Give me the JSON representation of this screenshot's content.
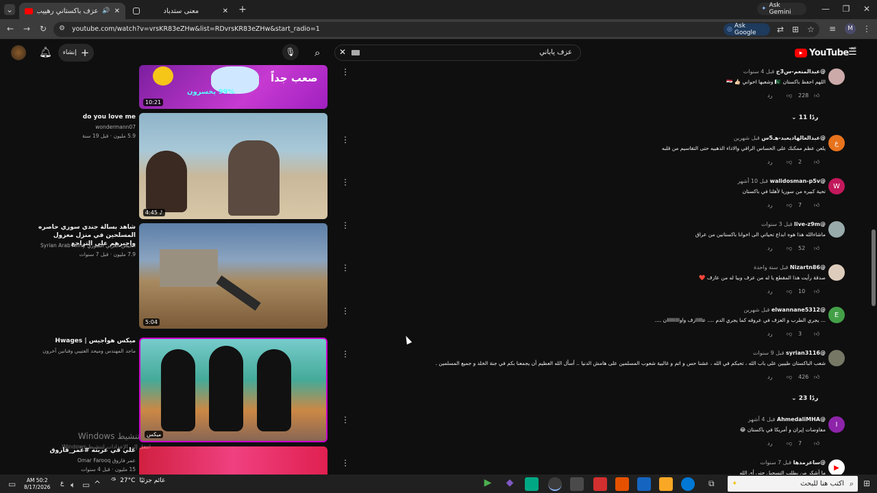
{
  "browser": {
    "tabs": [
      {
        "title": "عزف باكستاني رهييب ! - YouTube",
        "active": true
      },
      {
        "title": "معنى ستدباد",
        "active": false
      }
    ],
    "ask_gemini": "Ask Gemini",
    "url": "youtube.com/watch?v=vrsKR83eZHw&list=RDvrsKR83eZHw&start_radio=1",
    "ask_google": "Ask Google",
    "profile_initial": "M"
  },
  "youtube": {
    "logo": "YouTube",
    "logo_region": "AE",
    "search_value": "عزف ياباني",
    "create_label": "إنشاء"
  },
  "videos": [
    {
      "title": "",
      "channel": "",
      "meta": "",
      "duration": "10:21",
      "thumb_text": "صعب جداً",
      "thumb_text2": "99% يخسرون"
    },
    {
      "title": "do you love me",
      "channel": "wondermann07",
      "views": "5.9 مليون",
      "age": "قبل 19 سنة",
      "duration": "4:45 ♪"
    },
    {
      "title": "شاهد بسالة جندي سوري حاصره المسلحين في منزل معزول واجبرهم على التراجع",
      "channel": "الجيش العربي السوري Syrian Arab Army",
      "views": "7.9 مليون",
      "age": "قبل 7 سنوات",
      "duration": "5:04"
    },
    {
      "title": "ميكس هواجيس | Hwages",
      "channel": "ماجد المهندس وميحد العتيبي وفنانين آخرون",
      "duration": "ميكس"
    },
    {
      "title": "علي في غربته #عمر_فاروق",
      "channel": "عمر فاروق Omar Farooq",
      "views": "15 مليون",
      "age": "قبل 4 سنوات",
      "duration": ""
    }
  ],
  "windows_watermark": [
    "Windows تنشيط",
    "انتقل إلى الإعدادات لتنشيط Windows."
  ],
  "comments": [
    {
      "user": "@عبدالمنعم-س3ج",
      "time": "قبل 4 سنوات",
      "text": "اللهم احفظ باكستان 🇵🇰 وشعبها اخواني 👍🏻 🇮🇶",
      "likes": "228",
      "reply": "رد",
      "avatar_color": "#caa",
      "avatar_letter": ""
    },
    {
      "replies": "11 ردًا"
    },
    {
      "user": "@عبدالعالهاديعبد-هـ5س",
      "time": "قبل شهرين",
      "text": "يلعن عظم ممكنك على الحساس الراقي والاداء الذهبيه حتى التقاسيم من قلبه",
      "likes": "2",
      "reply": "رد",
      "avatar_color": "#e8731d",
      "avatar_letter": "ع"
    },
    {
      "user": "@walidosman-p5v",
      "time": "قبل 10 أشهر",
      "text": "تحية كبيره من سوريا لأهلنا في باكستان",
      "likes": "7",
      "reply": "رد",
      "avatar_color": "#c2185b",
      "avatar_letter": "W"
    },
    {
      "user": "@live-z9m",
      "time": "قبل 3 سنوات",
      "text": "ماشاءالله هذا هوه ابداع تحياتي الى اخوانا باكستانين من عراق",
      "likes": "52",
      "reply": "رد",
      "avatar_color": "#9aa",
      "avatar_letter": ""
    },
    {
      "user": "@Nizartn86",
      "time": "قبل سنة واحدة",
      "text": "صدقة رأيت هذا المقطع يا له من عزف وبيا له من عازف ❤️",
      "likes": "10",
      "reply": "رد",
      "avatar_color": "#dcb",
      "avatar_letter": ""
    },
    {
      "user": "@elwannane5312",
      "time": "قبل شهرين",
      "text": "... يجري الطرب و العزف في عروقه كما يجري الدم .... عااااازف واوااااااااان ....",
      "likes": "3",
      "reply": "رد",
      "avatar_color": "#43a047",
      "avatar_letter": "E"
    },
    {
      "user": "@syrian3116",
      "time": "قبل 9 سنوات",
      "text": "شعب الباكستان طيبين على باب الله ، تحبكم في الله ، عشنا حس و اتم و غالبية شعوب المسلمين على هامش الدنيا .. أسأل الله العظيم أن يجمعنا بكم في جنة الخلد و جميع المسلمين .",
      "likes": "426",
      "reply": "رد",
      "avatar_color": "#776",
      "avatar_letter": ""
    },
    {
      "replies": "23 ردًا"
    },
    {
      "user": "@AhmedaliMHA",
      "time": "قبل 4 أشهر",
      "text": "مفاوضات إيران و أمريكا في باكستان 😂",
      "likes": "7",
      "reply": "رد",
      "avatar_color": "#8e24aa",
      "avatar_letter": "I"
    },
    {
      "user": "@ساعرمدها",
      "time": "قبل 7 سنوات",
      "text": "ما أشكر من يطلب التسجيل حتى أي الله",
      "likes": "",
      "reply": "",
      "avatar_color": "#fff",
      "avatar_letter": "▶"
    }
  ],
  "taskbar": {
    "search_placeholder": "اكتب هنا للبحث",
    "weather_temp": "27°C",
    "weather_desc": "غائم جزئيًا",
    "time": "AM 50:2",
    "date": "8/17/2026",
    "lang": "ع"
  }
}
